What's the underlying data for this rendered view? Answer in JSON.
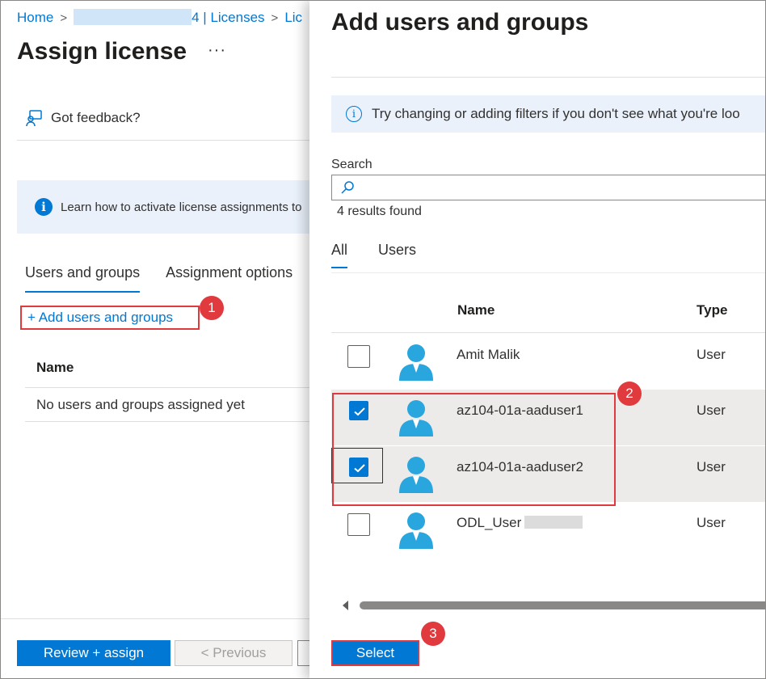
{
  "breadcrumb": {
    "home": "Home",
    "current_suffix": "4 | Licenses",
    "next": "Lic"
  },
  "left_blade": {
    "title": "Assign license",
    "more": "···",
    "feedback": "Got feedback?",
    "info_text": "Learn how to activate license assignments to",
    "tabs": [
      "Users and groups",
      "Assignment options"
    ],
    "add_link": "+ Add users and groups",
    "table_header": "Name",
    "empty_text": "No users and groups assigned yet",
    "buttons": {
      "review": "Review + assign",
      "previous": "< Previous"
    }
  },
  "panel": {
    "title": "Add users and groups",
    "info_text": "Try changing or adding filters if you don't see what you're loo",
    "search_label": "Search",
    "search_value": "",
    "results": "4 results found",
    "tabs": [
      "All",
      "Users"
    ],
    "columns": {
      "name": "Name",
      "type": "Type"
    },
    "rows": [
      {
        "name": "Amit Malik",
        "type": "User",
        "checked": false
      },
      {
        "name": "az104-01a-aaduser1",
        "type": "User",
        "checked": true
      },
      {
        "name": "az104-01a-aaduser2",
        "type": "User",
        "checked": true
      },
      {
        "name": "ODL_User",
        "type": "User",
        "checked": false
      }
    ],
    "select_button": "Select"
  },
  "annotations": {
    "step1": "1",
    "step2": "2",
    "step3": "3"
  },
  "colors": {
    "accent": "#0078d4",
    "annotation": "#e0393e",
    "selected_row": "#edebe9"
  },
  "icons": [
    "chevron-right-icon",
    "feedback-icon",
    "info-icon",
    "search-icon",
    "user-avatar-icon",
    "checkmark-icon",
    "scroll-left-icon"
  ]
}
